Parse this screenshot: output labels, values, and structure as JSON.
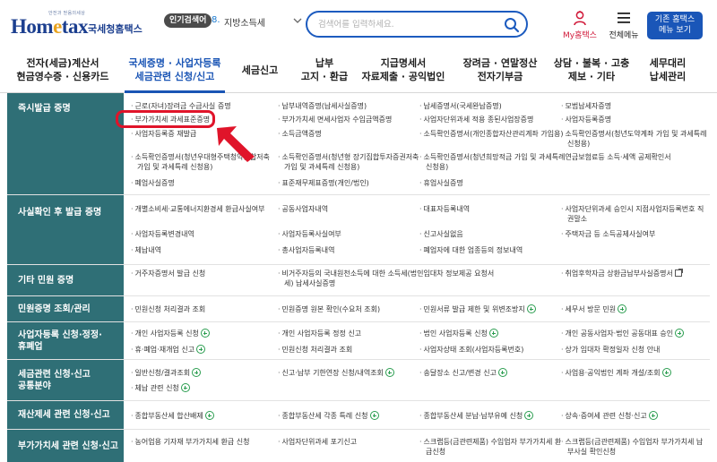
{
  "header": {
    "logo_small": "안전과 믿음의세상",
    "logo_main_a": "Hom",
    "logo_main_b": "tax",
    "logo_sub": "국세청홈택스",
    "popular_label": "인기검색어",
    "popular_rank": "8.",
    "popular_term": "지방소득세",
    "search_placeholder": "검색어를 입력하세요.",
    "my_label": "My홈택스",
    "menu_label": "전체메뉴",
    "old_hometax_line1": "기존 홈택스",
    "old_hometax_line2": "메뉴 보기",
    "colors": {
      "brand": "#1c3f8f",
      "accent": "#1a55b5",
      "category_bg": "#2f6f76",
      "highlight": "#e0142a"
    }
  },
  "nav": [
    {
      "line1": "전자(세금)계산서",
      "line2": "현금영수증 · 신용카드"
    },
    {
      "line1": "국세증명 · 사업자등록",
      "line2": "세금관련 신청/신고",
      "active": true
    },
    {
      "line1": "세금신고",
      "line2": ""
    },
    {
      "line1": "납부",
      "line2": "고지 · 환급"
    },
    {
      "line1": "지급명세서",
      "line2": "자료제출 · 공익법인"
    },
    {
      "line1": "장려금 · 연말정산",
      "line2": "전자기부금"
    },
    {
      "line1": "상담 · 불복 · 고충",
      "line2": "제보 · 기타"
    },
    {
      "line1": "세무대리",
      "line2": "납세관리"
    }
  ],
  "rows": [
    {
      "category": "즉시발급 증명",
      "items": [
        "근로(자녀)장려금 수급사실 증명",
        "납부내역증명(납세사실증명)",
        "납세증명서(국세완납증명)",
        "모범납세자증명",
        "부가가치세 과세표준증명",
        "부가가치세 면세사업자 수입금액증명",
        "사업자단위과세 적용 종된사업장증명",
        "사업자등록증명",
        "사업자등록증 재발급",
        "소득금액증명",
        "소득확인증명서(개인종합자산관리계좌 가입용)",
        "소득확인증명서(청년도약계좌 가입 및 과세특례",
        "신청용)",
        "소득확인증명서(청년우대형주택청약종합저축",
        "가입 및 과세특례 신청용)",
        "소득확인증명서(청년형 장기집합투자증권저축",
        "가입 및 과세특례 신청용)",
        "소득확인증명서(청년희망적금 가입 및 과세특례",
        "신청용)",
        "연금보험료등 소득·세액 공제확인서",
        "폐업사실증명",
        "표준재무제표증명(개인/법인)",
        "휴업사실증명"
      ]
    },
    {
      "category": "사실확인 후 발급 증명",
      "items": [
        "개별소비세·교통에너지환경세 환급사실여부",
        "공동사업자내역",
        "대표자등록내역",
        "사업자단위과세 승인시 지점사업자등록번호 직",
        "권말소",
        "사업자등록변경내역",
        "사업자등록사실여부",
        "신고사실없음",
        "주택자금 등 소득공제사실여부",
        "체납내역",
        "총사업자등록내역",
        "폐업자에 대한 업종등의 정보내역"
      ]
    },
    {
      "category": "기타 민원 증명",
      "items": [
        "거주자증명서 발급 신청",
        "비거주자등의 국내원천소득에 대한 소득세(법인",
        "세) 납세사실증명",
        "임대차 정보제공 요청서",
        "취업후학자금 상환금납부사실증명서"
      ]
    },
    {
      "category": "민원증명 조회/관리",
      "items": [
        "민원신청 처리결과 조회",
        "민원증명 원본 확인(수요처 조회)",
        "민원서류 발급 제한 및 위변조방지",
        "세무서 방문 민원"
      ]
    },
    {
      "category_line1": "사업자등록 신청·정정·",
      "category_line2": "휴폐업",
      "items": [
        "개인 사업자등록 신청",
        "개인 사업자등록 정정 신고",
        "법인 사업자등록 신청",
        "개인 공동사업자·법인 공동대표 승인",
        "휴·폐업·재개업 신고",
        "민원신청 처리결과 조회",
        "사업자상태 조회(사업자등록번호)",
        "상가 임대차 확정일자 신청 안내"
      ]
    },
    {
      "category_line1": "세금관련 신청·신고",
      "category_line2": "공통분야",
      "items": [
        "일반신청/결과조회",
        "신고·납부 기한연장 신청/내역조회",
        "송달장소 신고/변경 신고",
        "사업용·공익법인 계좌 개설/조회",
        "체납 관련 신청"
      ]
    },
    {
      "category": "재산제세 관련 신청·신고",
      "items": [
        "종합부동산세 합산배제",
        "종합부동산세 각종 특례 신청",
        "종합부동산세 분납·납부유예 신청",
        "상속·증여세 관련 신청·신고"
      ]
    },
    {
      "category": "부가가치세 관련 신청·신고",
      "items": [
        "농어업용 기자재 부가가치세 환급 신청",
        "사업자단위과세 포기신고",
        "스크랩등(금관련제품) 수입업자 부가가치세 환",
        "급신청",
        "스크랩등(금관련제품) 수입업자 부가가치세 납",
        "부사실 확인신청"
      ]
    }
  ]
}
